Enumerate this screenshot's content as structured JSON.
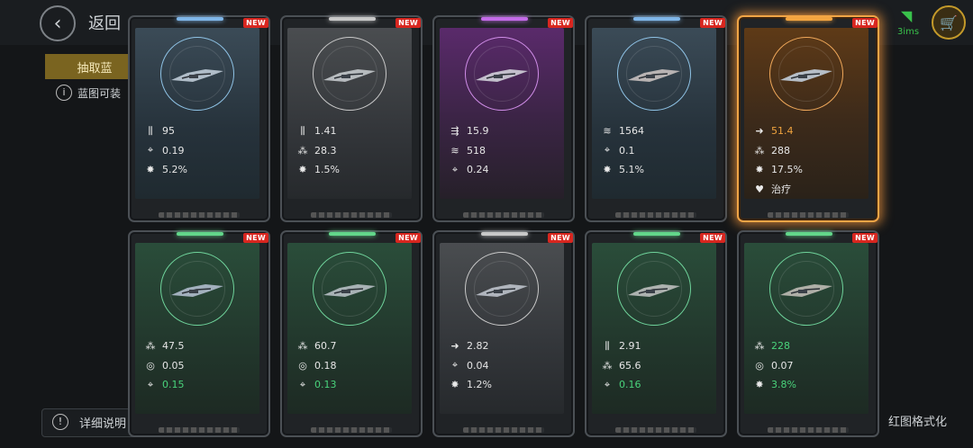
{
  "background": {
    "back_label": "返回",
    "tab_label": "抽取蓝",
    "info_text": "蓝图可装",
    "detail_label": "详细说明",
    "format_label": "红图格式化",
    "ping": "3ims"
  },
  "new_badge": "NEW",
  "cards": [
    {
      "theme": "blue",
      "bar": "#7fb6e8",
      "bg": "linear-gradient(180deg,#3b4b57 0%,#26323b 60%,#1f2a30 100%)",
      "ring": "#8fc3e6",
      "ship_color": "#c7d3df",
      "stats": [
        {
          "icon": "ammo",
          "glyph": "⫼",
          "value": "95",
          "tone": "normal"
        },
        {
          "icon": "crosshair",
          "glyph": "⌖",
          "value": "0.19",
          "tone": "normal"
        },
        {
          "icon": "crit",
          "glyph": "✸",
          "value": "5.2%",
          "tone": "normal"
        }
      ]
    },
    {
      "theme": "gray",
      "bar": "#c8c8c8",
      "bg": "linear-gradient(180deg,#4a4d50 0%,#33363a 60%,#26292c 100%)",
      "ring": "#c8c8c8",
      "ship_color": "#cbd0d4",
      "stats": [
        {
          "icon": "ammo",
          "glyph": "⫼",
          "value": "1.41",
          "tone": "normal"
        },
        {
          "icon": "cluster",
          "glyph": "⁂",
          "value": "28.3",
          "tone": "normal"
        },
        {
          "icon": "crit",
          "glyph": "✸",
          "value": "1.5%",
          "tone": "normal"
        }
      ]
    },
    {
      "theme": "purple",
      "bar": "#c46be8",
      "bg": "linear-gradient(180deg,#5a2a6b 0%,#3a2444 55%,#262029 100%)",
      "ring": "#d08de8",
      "ship_color": "#d8dbe0",
      "stats": [
        {
          "icon": "speed",
          "glyph": "⇶",
          "value": "15.9",
          "tone": "normal"
        },
        {
          "icon": "armor",
          "glyph": "≋",
          "value": "518",
          "tone": "normal"
        },
        {
          "icon": "crosshair",
          "glyph": "⌖",
          "value": "0.24",
          "tone": "normal"
        }
      ]
    },
    {
      "theme": "blue",
      "bar": "#7fb6e8",
      "bg": "linear-gradient(180deg,#3b4b57 0%,#26323b 60%,#1f2a30 100%)",
      "ring": "#8fc3e6",
      "ship_color": "#d0c8c6",
      "stats": [
        {
          "icon": "armor",
          "glyph": "≋",
          "value": "1564",
          "tone": "normal"
        },
        {
          "icon": "crosshair",
          "glyph": "⌖",
          "value": "0.1",
          "tone": "normal"
        },
        {
          "icon": "crit",
          "glyph": "✸",
          "value": "5.1%",
          "tone": "normal"
        }
      ]
    },
    {
      "theme": "orange",
      "bar": "#f3a540",
      "bg": "linear-gradient(180deg,#5e3a17 0%,#3c2a1a 55%,#2a2219 100%)",
      "ring": "#f0a85a",
      "ship_color": "#c9d7e6",
      "selected": true,
      "stats": [
        {
          "icon": "arrow",
          "glyph": "➜",
          "value": "51.4",
          "tone": "orange"
        },
        {
          "icon": "cluster",
          "glyph": "⁂",
          "value": "288",
          "tone": "normal"
        },
        {
          "icon": "crit",
          "glyph": "✸",
          "value": "17.5%",
          "tone": "normal"
        },
        {
          "icon": "heal",
          "glyph": "♥",
          "value": "治疗",
          "tone": "normal"
        }
      ]
    },
    {
      "theme": "green",
      "bar": "#62d68a",
      "bg": "linear-gradient(180deg,#2a4d3a 0%,#22372c 60%,#1d2a23 100%)",
      "ring": "#6fd39b",
      "ship_color": "#b8c3d6",
      "stats": [
        {
          "icon": "cluster",
          "glyph": "⁂",
          "value": "47.5",
          "tone": "normal"
        },
        {
          "icon": "target",
          "glyph": "◎",
          "value": "0.05",
          "tone": "normal"
        },
        {
          "icon": "crosshair",
          "glyph": "⌖",
          "value": "0.15",
          "tone": "green"
        }
      ]
    },
    {
      "theme": "green",
      "bar": "#62d68a",
      "bg": "linear-gradient(180deg,#2a4d3a 0%,#22372c 60%,#1d2a23 100%)",
      "ring": "#6fd39b",
      "ship_color": "#c0c6cc",
      "stats": [
        {
          "icon": "cluster",
          "glyph": "⁂",
          "value": "60.7",
          "tone": "normal"
        },
        {
          "icon": "target",
          "glyph": "◎",
          "value": "0.18",
          "tone": "normal"
        },
        {
          "icon": "crosshair",
          "glyph": "⌖",
          "value": "0.13",
          "tone": "green"
        }
      ]
    },
    {
      "theme": "gray",
      "bar": "#c8c8c8",
      "bg": "linear-gradient(180deg,#4a4d50 0%,#33363a 60%,#26292c 100%)",
      "ring": "#c8c8c8",
      "ship_color": "#c4c9d2",
      "stats": [
        {
          "icon": "arrow",
          "glyph": "➜",
          "value": "2.82",
          "tone": "normal"
        },
        {
          "icon": "crosshair",
          "glyph": "⌖",
          "value": "0.04",
          "tone": "normal"
        },
        {
          "icon": "crit",
          "glyph": "✸",
          "value": "1.2%",
          "tone": "normal"
        }
      ]
    },
    {
      "theme": "green",
      "bar": "#62d68a",
      "bg": "linear-gradient(180deg,#2a4d3a 0%,#22372c 60%,#1d2a23 100%)",
      "ring": "#6fd39b",
      "ship_color": "#c6c6c6",
      "stats": [
        {
          "icon": "ammo",
          "glyph": "⫼",
          "value": "2.91",
          "tone": "normal"
        },
        {
          "icon": "cluster",
          "glyph": "⁂",
          "value": "65.6",
          "tone": "normal"
        },
        {
          "icon": "crosshair",
          "glyph": "⌖",
          "value": "0.16",
          "tone": "green"
        }
      ]
    },
    {
      "theme": "green",
      "bar": "#62d68a",
      "bg": "linear-gradient(180deg,#2a4d3a 0%,#22372c 60%,#1d2a23 100%)",
      "ring": "#6fd39b",
      "ship_color": "#c8c2bc",
      "stats": [
        {
          "icon": "cluster",
          "glyph": "⁂",
          "value": "228",
          "tone": "green"
        },
        {
          "icon": "target",
          "glyph": "◎",
          "value": "0.07",
          "tone": "normal"
        },
        {
          "icon": "crit",
          "glyph": "✸",
          "value": "3.8%",
          "tone": "green"
        }
      ]
    }
  ]
}
